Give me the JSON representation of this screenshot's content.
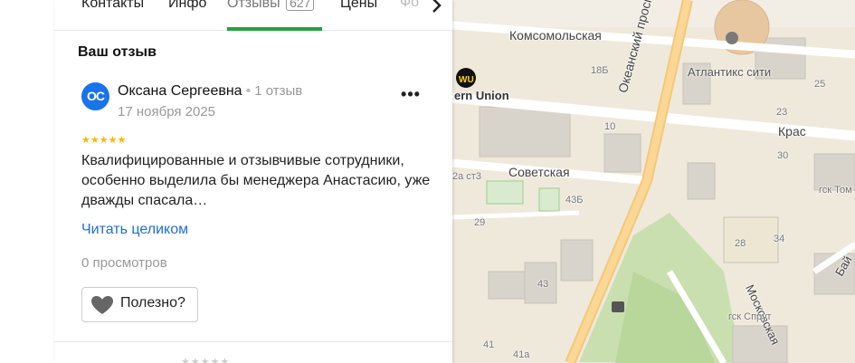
{
  "tabs": {
    "items": [
      {
        "label": "Контакты"
      },
      {
        "label": "Инфо"
      },
      {
        "label": "Отзывы",
        "badge": "627"
      },
      {
        "label": "Цены"
      },
      {
        "label": "Фо"
      }
    ],
    "active_color": "#22a144",
    "next_icon": "chevron-right-icon"
  },
  "review": {
    "section_title": "Ваш отзыв",
    "avatar_initials": "ОС",
    "avatar_color": "#1a73e8",
    "author_name": "Оксана Сергеевна",
    "author_reviews": "1 отзыв",
    "date": "17 ноября 2025",
    "rating": 5,
    "stars": "★★★★★",
    "text": "Квалифицированные и отзывчивые сотрудники, особенно выделила бы менеджера Анастасию, уже дважды спасала…",
    "read_more": "Читать целиком",
    "views": "0 просмотров",
    "useful_label": "Полезно?",
    "more_icon": "more-dots-icon"
  },
  "map": {
    "streets": {
      "komsomolskaya": "Комсомольская",
      "sovetskaya": "Советская",
      "okeansky": "Океанский проспект",
      "moskovskaya": "Московская",
      "kras": "Крас",
      "bai": "Бай"
    },
    "pois": {
      "western_union": "ern Union",
      "atlantiks": "Атлантикс сити",
      "gsk_tom": "гск Том",
      "gsk_sprut": "гск Спрут"
    },
    "numbers": {
      "n18b": "18Б",
      "n10": "10",
      "n23": "23",
      "n25": "25",
      "n30": "30",
      "n2ast3": "2а ст3",
      "n43b": "43Б",
      "n29": "29",
      "n43": "43",
      "n28": "28",
      "n34": "34",
      "n41": "41",
      "n41a": "41а"
    }
  }
}
